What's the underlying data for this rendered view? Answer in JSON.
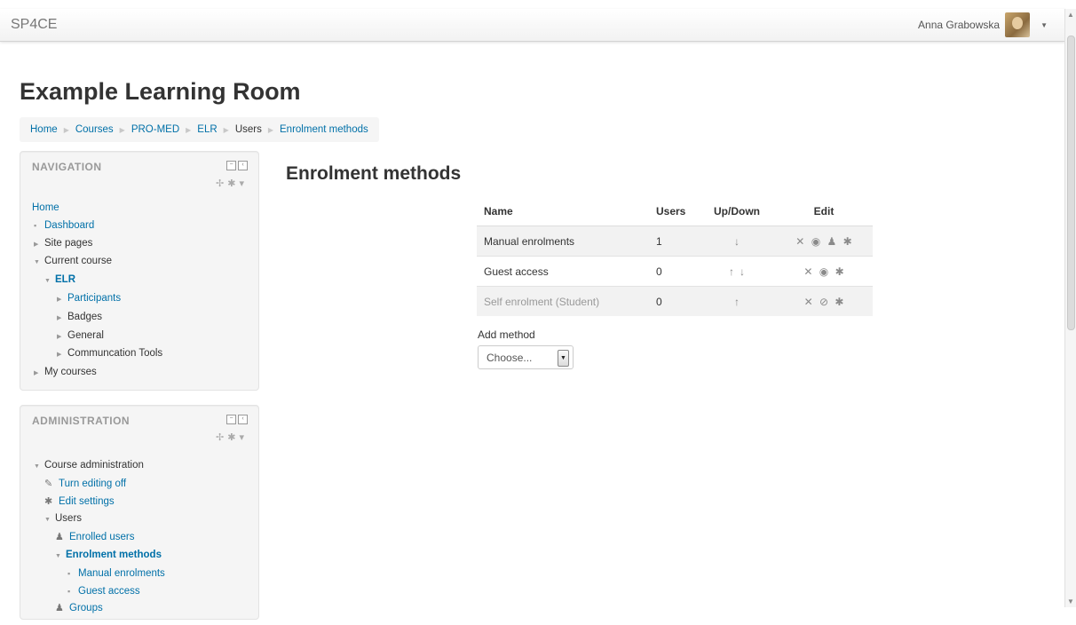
{
  "site": {
    "brand": "SP4CE"
  },
  "user": {
    "name": "Anna Grabowska"
  },
  "page": {
    "title": "Example Learning Room",
    "heading": "Enrolment methods"
  },
  "breadcrumb": [
    "Home",
    "Courses",
    "PRO-MED",
    "ELR",
    "Users",
    "Enrolment methods"
  ],
  "navigation": {
    "title": "NAVIGATION",
    "items": {
      "home": "Home",
      "dashboard": "Dashboard",
      "site_pages": "Site pages",
      "current_course": "Current course",
      "elr": "ELR",
      "participants": "Participants",
      "badges": "Badges",
      "general": "General",
      "communication": "Communcation Tools",
      "my_courses": "My courses"
    }
  },
  "administration": {
    "title": "ADMINISTRATION",
    "items": {
      "course_admin": "Course administration",
      "turn_editing_off": "Turn editing off",
      "edit_settings": "Edit settings",
      "users": "Users",
      "enrolled_users": "Enrolled users",
      "enrolment_methods": "Enrolment methods",
      "manual_enrolments": "Manual enrolments",
      "guest_access": "Guest access",
      "groups": "Groups"
    }
  },
  "table": {
    "headers": {
      "name": "Name",
      "users": "Users",
      "updown": "Up/Down",
      "edit": "Edit"
    },
    "rows": [
      {
        "name": "Manual enrolments",
        "users": "1",
        "updown": [
          "down"
        ],
        "edit": [
          "delete",
          "visible",
          "enrol-users",
          "settings"
        ],
        "disabled": false
      },
      {
        "name": "Guest access",
        "users": "0",
        "updown": [
          "up",
          "down"
        ],
        "edit": [
          "delete",
          "visible",
          "settings"
        ],
        "disabled": false
      },
      {
        "name": "Self enrolment (Student)",
        "users": "0",
        "updown": [
          "up"
        ],
        "edit": [
          "delete",
          "hidden",
          "settings"
        ],
        "disabled": true
      }
    ]
  },
  "add_method": {
    "label": "Add method",
    "selected": "Choose..."
  },
  "colors": {
    "link": "#0070a8",
    "block_bg": "#f5f5f5",
    "row_stripe": "#f2f2f2"
  }
}
